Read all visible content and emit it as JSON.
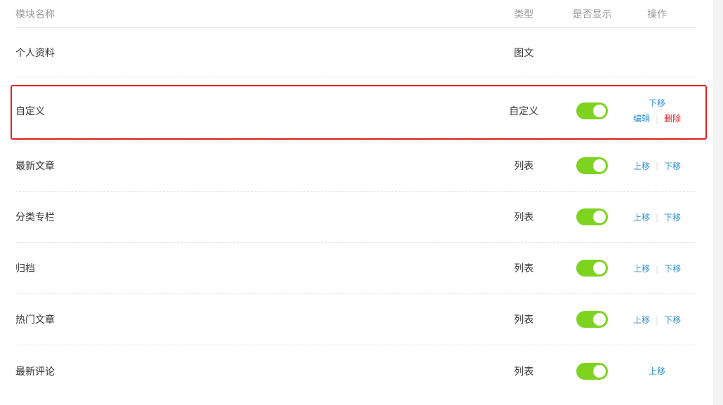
{
  "columns": {
    "name": "模块名称",
    "type": "类型",
    "show": "是否显示",
    "ops": "操作"
  },
  "rows": [
    {
      "name": "个人资料",
      "type": "图文",
      "show": null
    },
    {
      "name": "自定义",
      "type": "自定义",
      "show": true,
      "ops": {
        "down": "下移",
        "edit": "编辑",
        "delete": "删除"
      },
      "highlighted": true
    },
    {
      "name": "最新文章",
      "type": "列表",
      "show": true,
      "ops": {
        "up": "上移",
        "down": "下移"
      }
    },
    {
      "name": "分类专栏",
      "type": "列表",
      "show": true,
      "ops": {
        "up": "上移",
        "down": "下移"
      }
    },
    {
      "name": "归档",
      "type": "列表",
      "show": true,
      "ops": {
        "up": "上移",
        "down": "下移"
      }
    },
    {
      "name": "热门文章",
      "type": "列表",
      "show": true,
      "ops": {
        "up": "上移",
        "down": "下移"
      }
    },
    {
      "name": "最新评论",
      "type": "列表",
      "show": true,
      "ops": {
        "up": "上移"
      }
    }
  ],
  "colors": {
    "toggle_on": "#7ed321",
    "link": "#2e8fd8",
    "danger": "#d81e1e",
    "highlight_border": "#e0201f"
  }
}
